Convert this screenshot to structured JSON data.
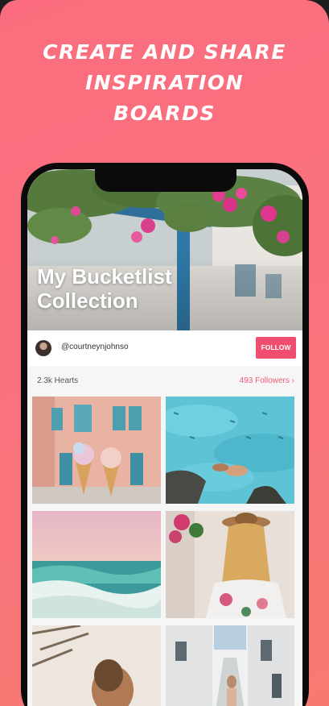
{
  "promo": {
    "headline_lines": [
      "CREATE AND SHARE",
      "INSPIRATION",
      "BOARDS"
    ],
    "background_colors": [
      "#fb6d7e",
      "#f77a72"
    ]
  },
  "board": {
    "title_lines": [
      "My Bucketlist",
      "Collection"
    ],
    "username": "@courtneynjohnso",
    "follow_label": "FOLLOW",
    "hearts": "2.3k Hearts",
    "followers": "493 Followers ›",
    "accent_color": "#f04e6e"
  },
  "photos": [
    {
      "name": "pink-building-ice-cream"
    },
    {
      "name": "turquoise-water-swimmer"
    },
    {
      "name": "ocean-waves-sunset"
    },
    {
      "name": "woman-hat-flowers"
    },
    {
      "name": "woman-sand-palms"
    },
    {
      "name": "white-alley-street"
    }
  ]
}
